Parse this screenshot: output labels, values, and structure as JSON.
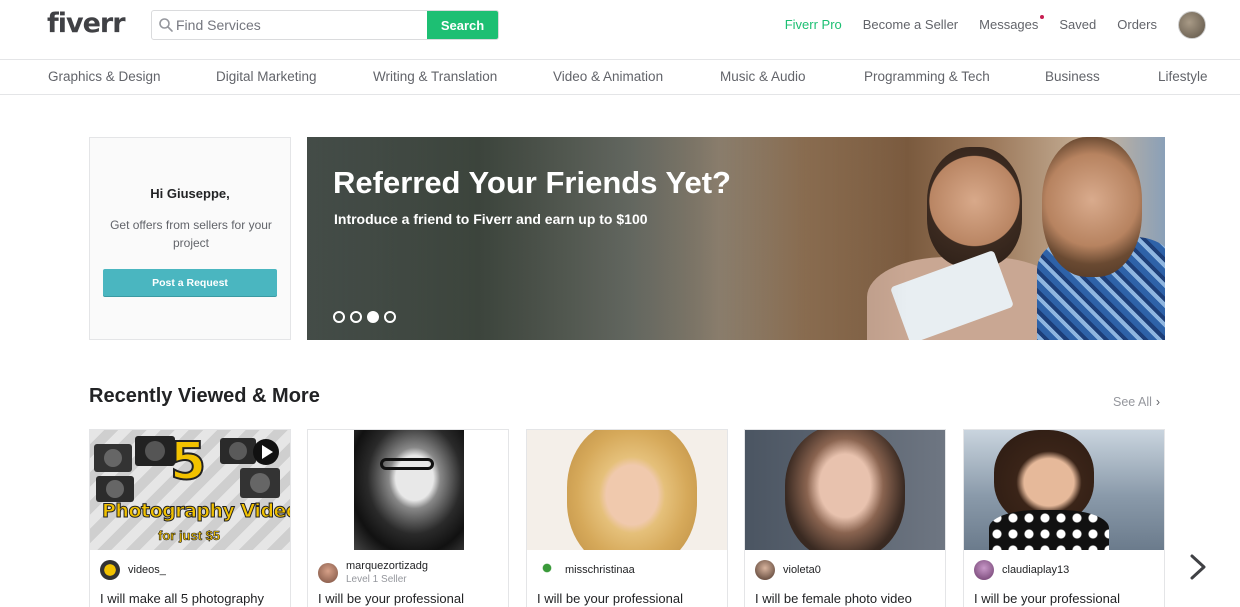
{
  "header": {
    "logo": "fiverr",
    "search": {
      "placeholder": "Find Services",
      "button_label": "Search"
    },
    "links": [
      "Fiverr Pro",
      "Become a Seller",
      "Messages",
      "Saved",
      "Orders"
    ]
  },
  "categories": [
    "Graphics & Design",
    "Digital Marketing",
    "Writing & Translation",
    "Video & Animation",
    "Music & Audio",
    "Programming & Tech",
    "Business",
    "Lifestyle"
  ],
  "welcome": {
    "title": "Hi Giuseppe,",
    "text": "Get offers from sellers for your project",
    "button_label": "Post a Request"
  },
  "banner": {
    "title": "Referred Your Friends Yet?",
    "subtitle": "Introduce a friend to Fiverr and earn up to $100",
    "slide_count": 4,
    "active_slide": 3
  },
  "recently_viewed": {
    "title": "Recently Viewed & More",
    "see_all": "See All",
    "cards": [
      {
        "seller": "videos_",
        "level": "",
        "title": "I will make all 5 photography",
        "image_text_1": "5",
        "image_text_2": "Photography Videos",
        "image_text_3": "for just $5"
      },
      {
        "seller": "marquezortizadg",
        "level": "Level 1 Seller",
        "title": "I will be your professional"
      },
      {
        "seller": "misschristinaa",
        "level": "",
        "title": "I will be your professional"
      },
      {
        "seller": "violeta0",
        "level": "",
        "title": "I will be female photo video"
      },
      {
        "seller": "claudiaplay13",
        "level": "",
        "title": "I will be your professional"
      }
    ]
  },
  "colors": {
    "brand_green": "#1dbf73",
    "teal_button": "#4ab6c0",
    "notification": "#c71e51"
  }
}
